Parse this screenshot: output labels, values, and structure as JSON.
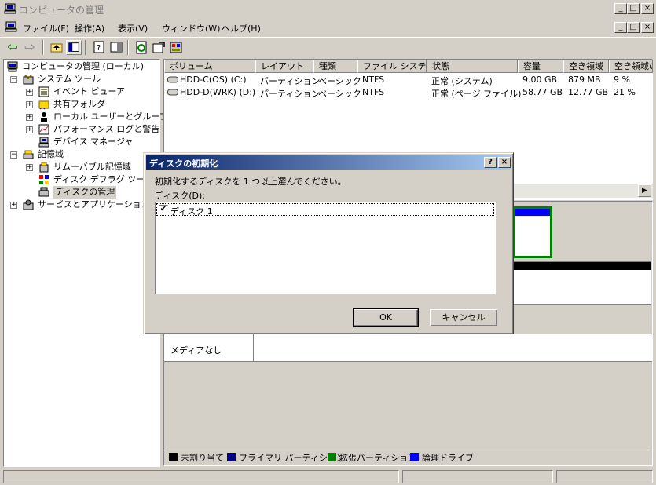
{
  "window": {
    "title": "コンピュータの管理",
    "caption_buttons": [
      "_",
      "□",
      "×"
    ],
    "mdi_buttons": [
      "_",
      "□",
      "×"
    ]
  },
  "menu": {
    "items": [
      "ファイル(F)",
      "操作(A)",
      "表示(V)",
      "ウィンドウ(W)",
      "ヘルプ(H)"
    ]
  },
  "toolbar": {
    "icons": [
      "back-arrow-icon",
      "forward-arrow-icon",
      "up-folder-icon",
      "show-hide-tree-icon",
      "properties-icon",
      "help-pane-icon",
      "refresh-icon",
      "export-list-icon",
      "settings-icon"
    ],
    "back_glyph": "⇦",
    "forward_glyph": "⇨"
  },
  "tree": {
    "root": "コンピュータの管理 (ローカル)",
    "system_tools": "システム ツール",
    "event_viewer": "イベント ビューア",
    "shared_folders": "共有フォルダ",
    "local_users": "ローカル ユーザーとグループ",
    "performance": "パフォーマンス ログと警告",
    "device_manager": "デバイス マネージャ",
    "storage": "記憶域",
    "removable": "リムーバブル記憶域",
    "defrag": "ディスク デフラグ ツール",
    "disk_management": "ディスクの管理",
    "services_apps": "サービスとアプリケーション",
    "expand_plus": "+",
    "expand_minus": "−"
  },
  "volume_list": {
    "columns": [
      "ボリューム",
      "レイアウト",
      "種類",
      "ファイル システム",
      "状態",
      "容量",
      "空き領域",
      "空き領域の"
    ],
    "rows": [
      [
        "HDD-C(OS) (C:)",
        "パーティション",
        "ベーシック",
        "NTFS",
        "正常 (システム)",
        "9.00 GB",
        "879 MB",
        "9 %"
      ],
      [
        "HDD-D(WRK) (D:)",
        "パーティション",
        "ベーシック",
        "NTFS",
        "正常 (ページ ファイル)",
        "58.77 GB",
        "12.77 GB",
        "21 %"
      ]
    ]
  },
  "disk_area": {
    "no_media": "メディアなし"
  },
  "legend": [
    {
      "label": "未割り当て",
      "color": "#000000"
    },
    {
      "label": "プライマリ パーティション",
      "color": "#000080"
    },
    {
      "label": "拡張パーティション",
      "color": "#008000"
    },
    {
      "label": "論理ドライブ",
      "color": "#0000ff"
    }
  ],
  "dialog": {
    "title": "ディスクの初期化",
    "help_glyph": "?",
    "close_glyph": "×",
    "instruction": "初期化するディスクを 1 つ以上選んでください。",
    "list_label": "ディスク(D):",
    "disks": [
      {
        "label": "ディスク 1",
        "checked": true
      }
    ],
    "check_glyph": "✔",
    "ok": "OK",
    "cancel": "キャンセル"
  },
  "scroll": {
    "right_glyph": "▶"
  }
}
